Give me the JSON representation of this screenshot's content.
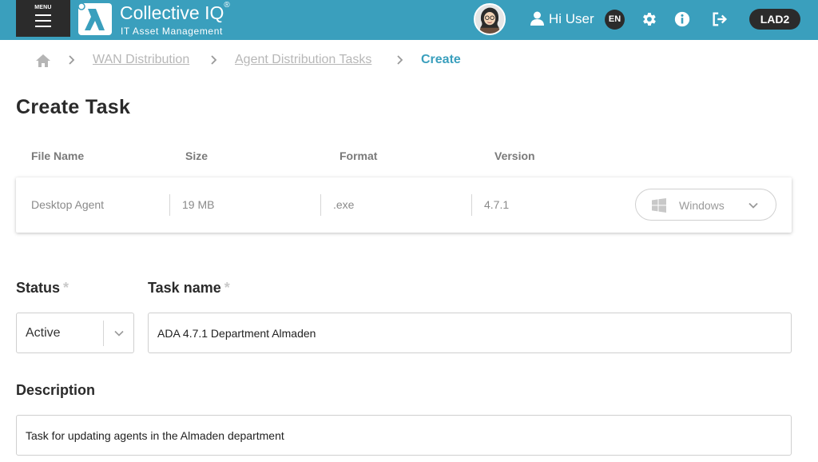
{
  "header": {
    "menu_label": "MENU",
    "app_title": "Collective IQ",
    "app_title_mark": "®",
    "app_subtitle": "IT Asset Management",
    "greeting": "Hi User",
    "language": "EN",
    "site_badge": "LAD2",
    "accent_color": "#3a9fbd",
    "icons": [
      "menu-icon",
      "logo-icon",
      "avatar",
      "user-icon",
      "gear-icon",
      "info-icon",
      "logout-icon"
    ]
  },
  "breadcrumb": {
    "home_icon": "home-icon",
    "items": [
      "WAN Distribution",
      "Agent Distribution Tasks"
    ],
    "current": "Create"
  },
  "page": {
    "title": "Create Task"
  },
  "file_table": {
    "columns": [
      "File Name",
      "Size",
      "Format",
      "Version"
    ],
    "row": {
      "file_name": "Desktop Agent",
      "size": "19 MB",
      "format": ".exe",
      "version": "4.7.1",
      "os": "Windows"
    }
  },
  "form": {
    "status": {
      "label": "Status",
      "required_mark": "*",
      "value": "Active"
    },
    "task_name": {
      "label": "Task name",
      "required_mark": "*",
      "value": "ADA 4.7.1 Department Almaden"
    },
    "description": {
      "label": "Description",
      "value": "Task for updating agents in the Almaden department"
    }
  }
}
